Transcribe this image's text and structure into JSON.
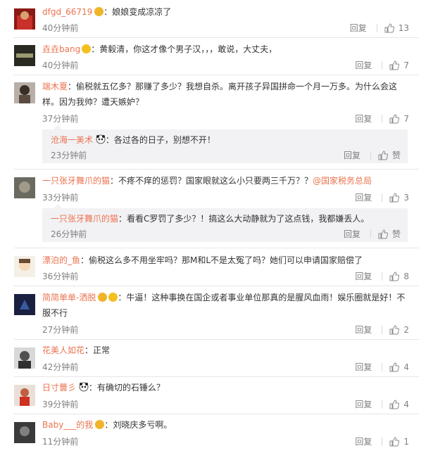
{
  "comments": [
    {
      "user": "dfgd_66719",
      "text": "：娘娘变成凉凉了",
      "time": "40分钟前",
      "reply": "回复",
      "likes": "13"
    },
    {
      "user": "垚垚bang",
      "text": "：黄毅清，你这才像个男子汉，，，敢说，大丈夫，",
      "time": "40分钟前",
      "reply": "回复",
      "likes": "7"
    },
    {
      "user": "端木夏",
      "text_line1": "：偷税就五亿多？那赚了多少？我想自杀。离开孩子异国拼命一个月一万多。为什么会这",
      "text_line2": "样。因为我帅？遭天嫉妒？",
      "time": "37分钟前",
      "reply": "回复",
      "likes": "7",
      "sub": {
        "user": "沧海一美术",
        "text": "：各过各的日子，别想不开！",
        "time": "23分钟前",
        "reply": "回复",
        "like_label": "赞"
      }
    },
    {
      "user": "一只张牙舞爪的猫",
      "text": "：不疼不痒的惩罚？国家眼就这么小只要两三千万？？",
      "mention": "@国家税务总局",
      "time": "33分钟前",
      "reply": "回复",
      "likes": "3",
      "sub": {
        "user": "一只张牙舞爪的猫",
        "text": "：看看C罗罚了多少？！搞这么大动静就为了这点钱，我都嫌丢人。",
        "time": "26分钟前",
        "reply": "回复",
        "like_label": "赞"
      }
    },
    {
      "user": "漂泊的_鱼",
      "text": "：偷税这么多不用坐牢吗？那M和L不是太冤了吗？她们可以申请国家赔偿了",
      "time": "36分钟前",
      "reply": "回复",
      "likes": "8"
    },
    {
      "user": "简简单单-洒脱",
      "text_line1": "：牛逼！这种事换在国企或者事业单位那真的是腥风血雨！娱乐圈就是好！不",
      "text_line2": "服不行",
      "time": "27分钟前",
      "reply": "回复",
      "likes": "2"
    },
    {
      "user": "花美人如花",
      "text": "：正常",
      "time": "42分钟前",
      "reply": "回复",
      "likes": "4"
    },
    {
      "user": "日寸曇彡",
      "text": "：有确切的石锤么？",
      "time": "39分钟前",
      "reply": "回复",
      "likes": "4"
    },
    {
      "user": "Baby___的我",
      "text": "：刘晓庆多亏啊。",
      "time": "11分钟前",
      "reply": "回复",
      "likes": "1"
    }
  ],
  "colors": {
    "username": "#eb7350",
    "text": "#333333",
    "meta": "#808080",
    "sub_bg": "#f2f2f5",
    "divider": "#e6e6e6"
  },
  "icons": [
    "thumbs-up-icon",
    "vip-badge-icon",
    "panda-emoji-icon"
  ]
}
